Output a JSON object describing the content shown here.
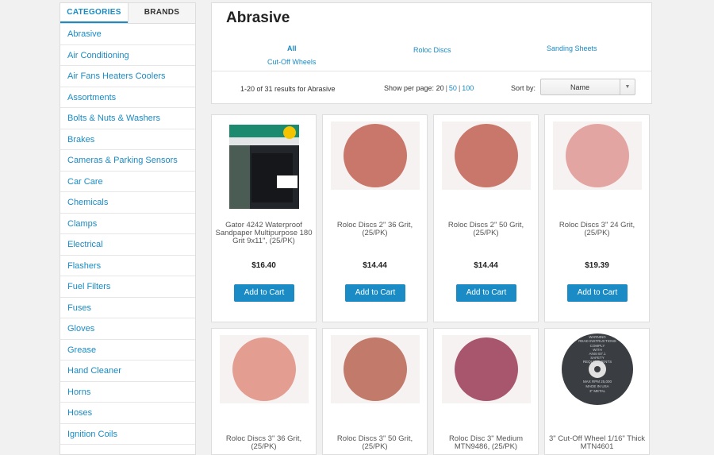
{
  "sidebar": {
    "tabs": [
      {
        "label": "CATEGORIES",
        "active": true
      },
      {
        "label": "BRANDS",
        "active": false
      }
    ],
    "categories": [
      "Abrasive",
      "Air Conditioning",
      "Air Fans Heaters Coolers",
      "Assortments",
      "Bolts & Nuts & Washers",
      "Brakes",
      "Cameras & Parking Sensors",
      "Car Care",
      "Chemicals",
      "Clamps",
      "Electrical",
      "Flashers",
      "Fuel Filters",
      "Fuses",
      "Gloves",
      "Grease",
      "Hand Cleaner",
      "Horns",
      "Hoses",
      "Ignition Coils"
    ]
  },
  "header": {
    "title": "Abrasive",
    "filters": [
      "All",
      "Roloc Discs",
      "Sanding Sheets",
      "Cut-Off Wheels"
    ],
    "results_text": "1-20 of 31 results for Abrasive",
    "per_page_label": "Show per page:",
    "per_page_current": "20",
    "per_page_options": [
      "50",
      "100"
    ],
    "sort_label": "Sort by:",
    "sort_value": "Name"
  },
  "products": [
    {
      "name": "Gator 4242 Waterproof Sandpaper Multipurpose 180 Grit 9x11\", (25/PK)",
      "price": "$16.40",
      "button": "Add to Cart",
      "image": "sandpaper-pack"
    },
    {
      "name": "Roloc Discs 2\" 36 Grit, (25/PK)",
      "price": "$14.44",
      "button": "Add to Cart",
      "image": "disc",
      "color": "#c9776a"
    },
    {
      "name": "Roloc Discs 2\" 50 Grit, (25/PK)",
      "price": "$14.44",
      "button": "Add to Cart",
      "image": "disc",
      "color": "#c9776a"
    },
    {
      "name": "Roloc Discs 3\" 24 Grit, (25/PK)",
      "price": "$19.39",
      "button": "Add to Cart",
      "image": "disc",
      "color": "#e3a5a1"
    },
    {
      "name": "Roloc Discs 3\" 36 Grit, (25/PK)",
      "price": "",
      "button": "",
      "image": "disc",
      "color": "#e49d91"
    },
    {
      "name": "Roloc Discs 3\" 50 Grit, (25/PK)",
      "price": "",
      "button": "",
      "image": "disc",
      "color": "#c27a6b"
    },
    {
      "name": "Roloc Disc 3\" Medium MTN9486, (25/PK)",
      "price": "",
      "button": "",
      "image": "disc",
      "color": "#a8556e"
    },
    {
      "name": "3\" Cut-Off Wheel 1/16\" Thick MTN4601",
      "price": "",
      "button": "",
      "image": "wheel",
      "wheel_text": [
        "WARNING",
        "READ INSTRUCTIONS",
        "COMPLY",
        "WITH",
        "ANSI B7.1",
        "SAFETY",
        "REQUIREMENTS",
        "MAX RPM 25,000",
        "MADE IN USA",
        "3\" METAL"
      ]
    }
  ],
  "colors": {
    "accent": "#1a8bc4"
  }
}
